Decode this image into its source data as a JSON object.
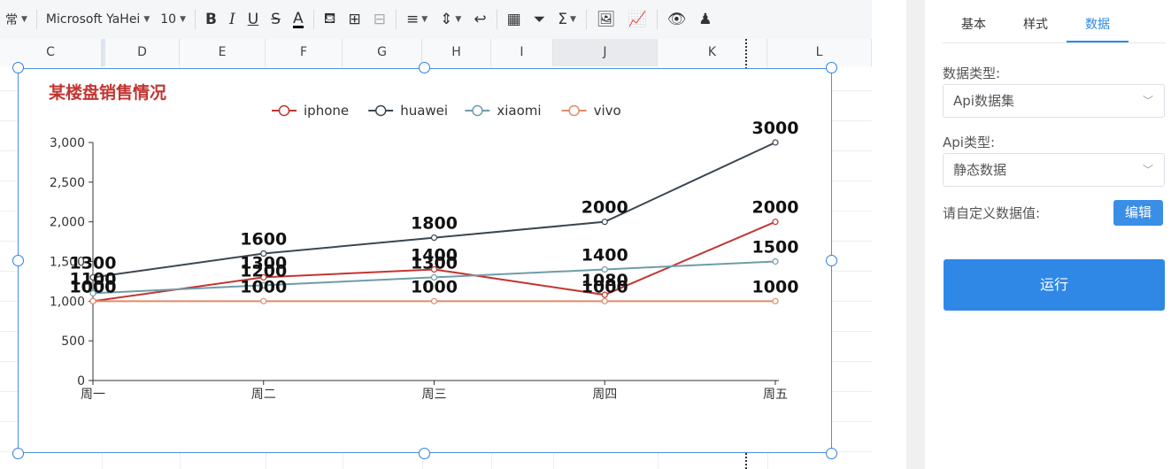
{
  "toolbar": {
    "style_label": "常",
    "font_name": "Microsoft YaHei",
    "font_size": "10",
    "bold_label": "B",
    "italic_label": "I",
    "underline_label": "U",
    "strike_label": "S",
    "fontcolor_label": "A"
  },
  "columns": [
    "C",
    "D",
    "E",
    "F",
    "G",
    "H",
    "I",
    "J",
    "K",
    "L"
  ],
  "panel": {
    "tabs": [
      "基本",
      "样式",
      "数据"
    ],
    "active_tab": "数据",
    "data_type_label": "数据类型:",
    "data_type_value": "Api数据集",
    "api_type_label": "Api类型:",
    "api_type_value": "静态数据",
    "custom_label": "请自定义数据值:",
    "edit_button": "编辑",
    "run_button": "运行"
  },
  "colors": {
    "accent": "#2f88e6",
    "title": "#c23531"
  },
  "chart_data": {
    "type": "line",
    "title": "某楼盘销售情况",
    "categories": [
      "周一",
      "周二",
      "周三",
      "周四",
      "周五"
    ],
    "ylim": [
      0,
      3000
    ],
    "y_ticks": [
      "0",
      "500",
      "1,000",
      "1,500",
      "2,000",
      "2,500",
      "3,000"
    ],
    "legend_position": "top-center",
    "grid": false,
    "series": [
      {
        "name": "iphone",
        "color": "#c23531",
        "values": [
          1000,
          1300,
          1400,
          1080,
          2000
        ]
      },
      {
        "name": "huawei",
        "color": "#3c4650",
        "values": [
          1300,
          1600,
          1800,
          2000,
          3000
        ]
      },
      {
        "name": "xiaomi",
        "color": "#6e9ca8",
        "values": [
          1100,
          1200,
          1300,
          1400,
          1500
        ]
      },
      {
        "name": "vivo",
        "color": "#e08c6a",
        "values": [
          1000,
          1000,
          1000,
          1000,
          1000
        ]
      }
    ],
    "data_labels": [
      [
        "1000",
        "1300",
        "1400",
        "1080",
        "2000"
      ],
      [
        "1300",
        "1600",
        "1800",
        "2000",
        "3000"
      ],
      [
        "1100",
        "1200",
        "1300",
        "1400",
        "1500"
      ],
      [
        "1000",
        "1000",
        "1000",
        "1000",
        "1000"
      ]
    ]
  }
}
